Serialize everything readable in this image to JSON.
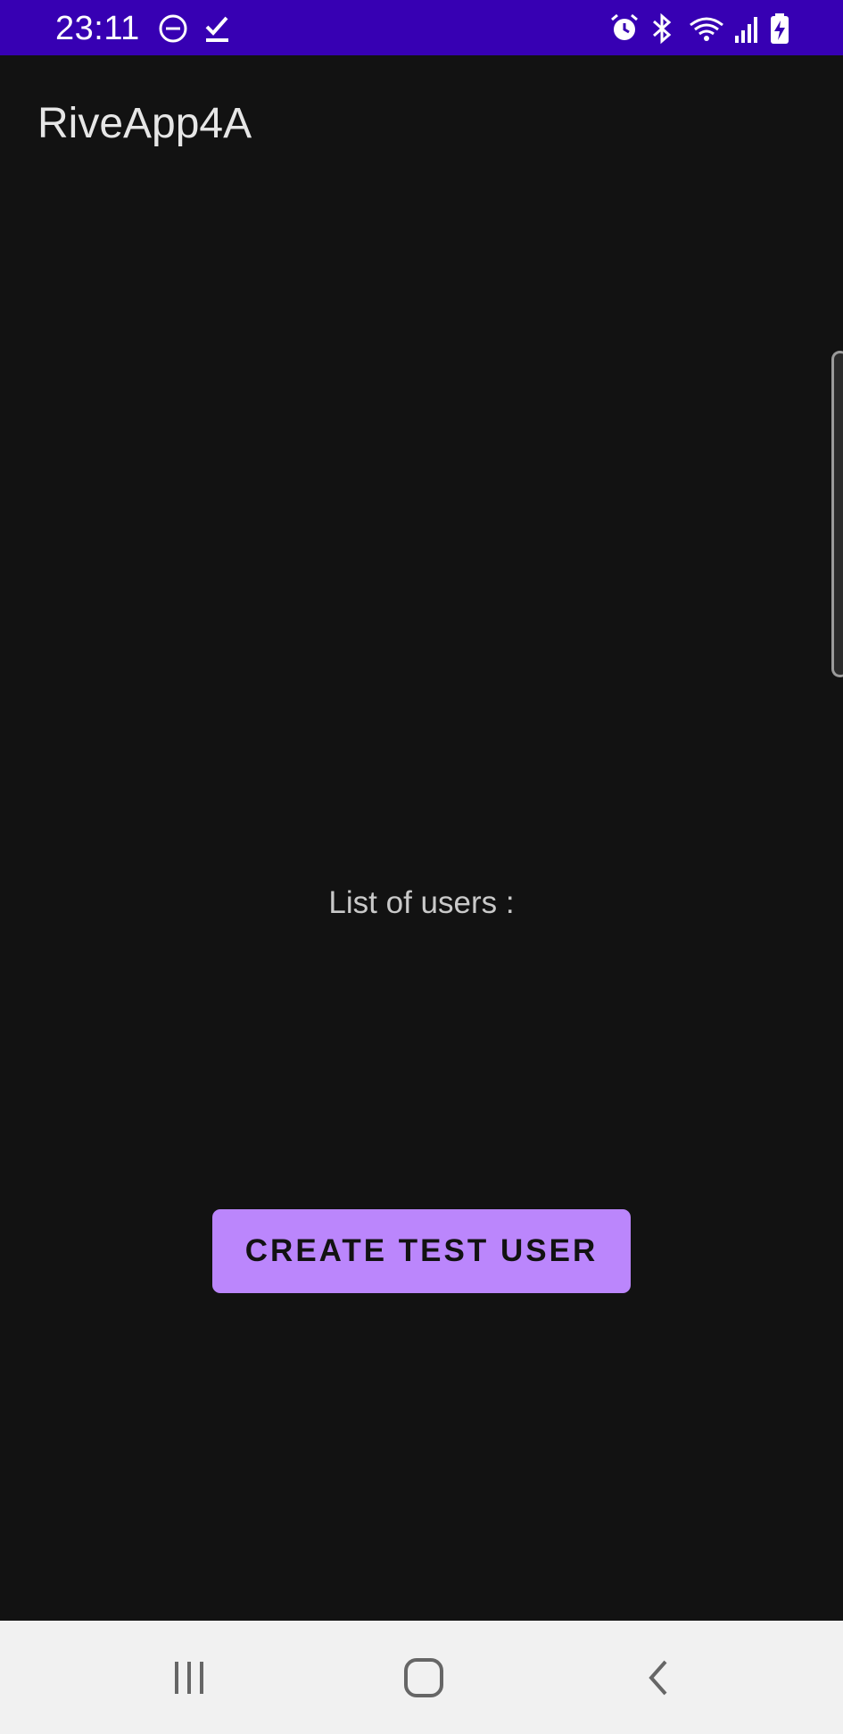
{
  "status_bar": {
    "time": "23:11",
    "background": "#3700B3",
    "left_icons": [
      "do-not-disturb-icon",
      "checkmark-icon"
    ],
    "right_icons": [
      "alarm-icon",
      "bluetooth-icon",
      "wifi-icon",
      "signal-icon",
      "battery-charging-icon"
    ]
  },
  "app_bar": {
    "title": "RiveApp4A"
  },
  "main": {
    "list_label": "List of users :",
    "create_button_label": "CREATE TEST USER",
    "accent_color": "#BB86FC"
  },
  "nav_bar": {
    "items": [
      "recent-apps",
      "home",
      "back"
    ]
  }
}
